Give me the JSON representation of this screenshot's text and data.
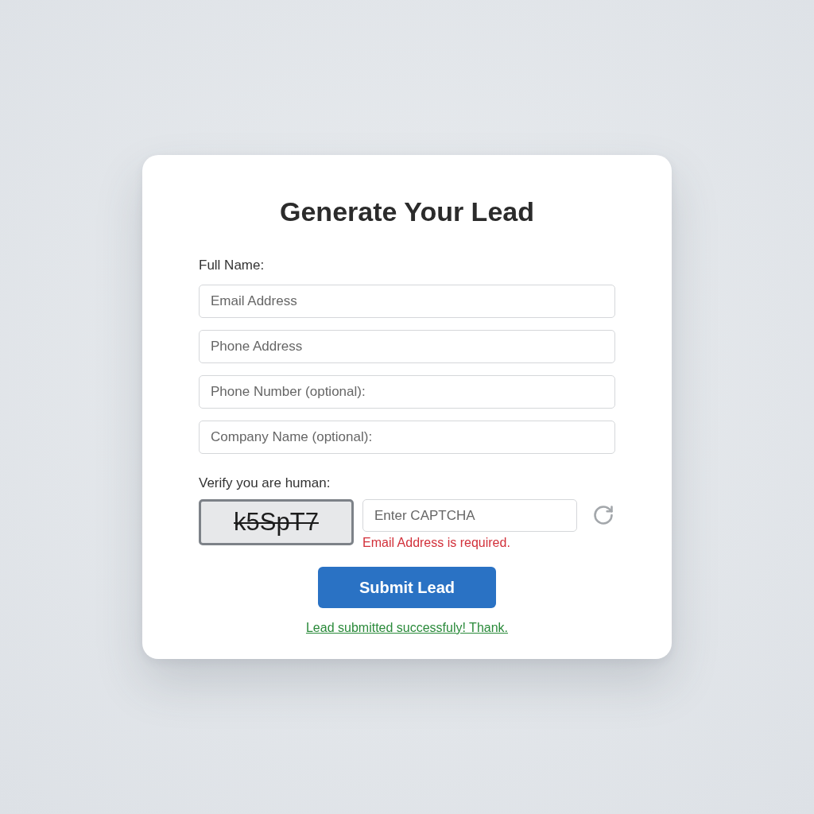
{
  "form": {
    "title": "Generate Your Lead",
    "name_label": "Full Name:",
    "fields": [
      {
        "placeholder": "Email Address"
      },
      {
        "placeholder": "Phone Address"
      },
      {
        "placeholder": "Phone Number (optional):"
      },
      {
        "placeholder": "Company Name (optional):"
      }
    ],
    "captcha": {
      "label": "Verify you are human:",
      "code": "k5SpT7",
      "placeholder": "Enter CAPTCHA",
      "error": "Email Address is required."
    },
    "submit": "Submit Lead",
    "success": "Lead submitted successfuly! Thank."
  }
}
